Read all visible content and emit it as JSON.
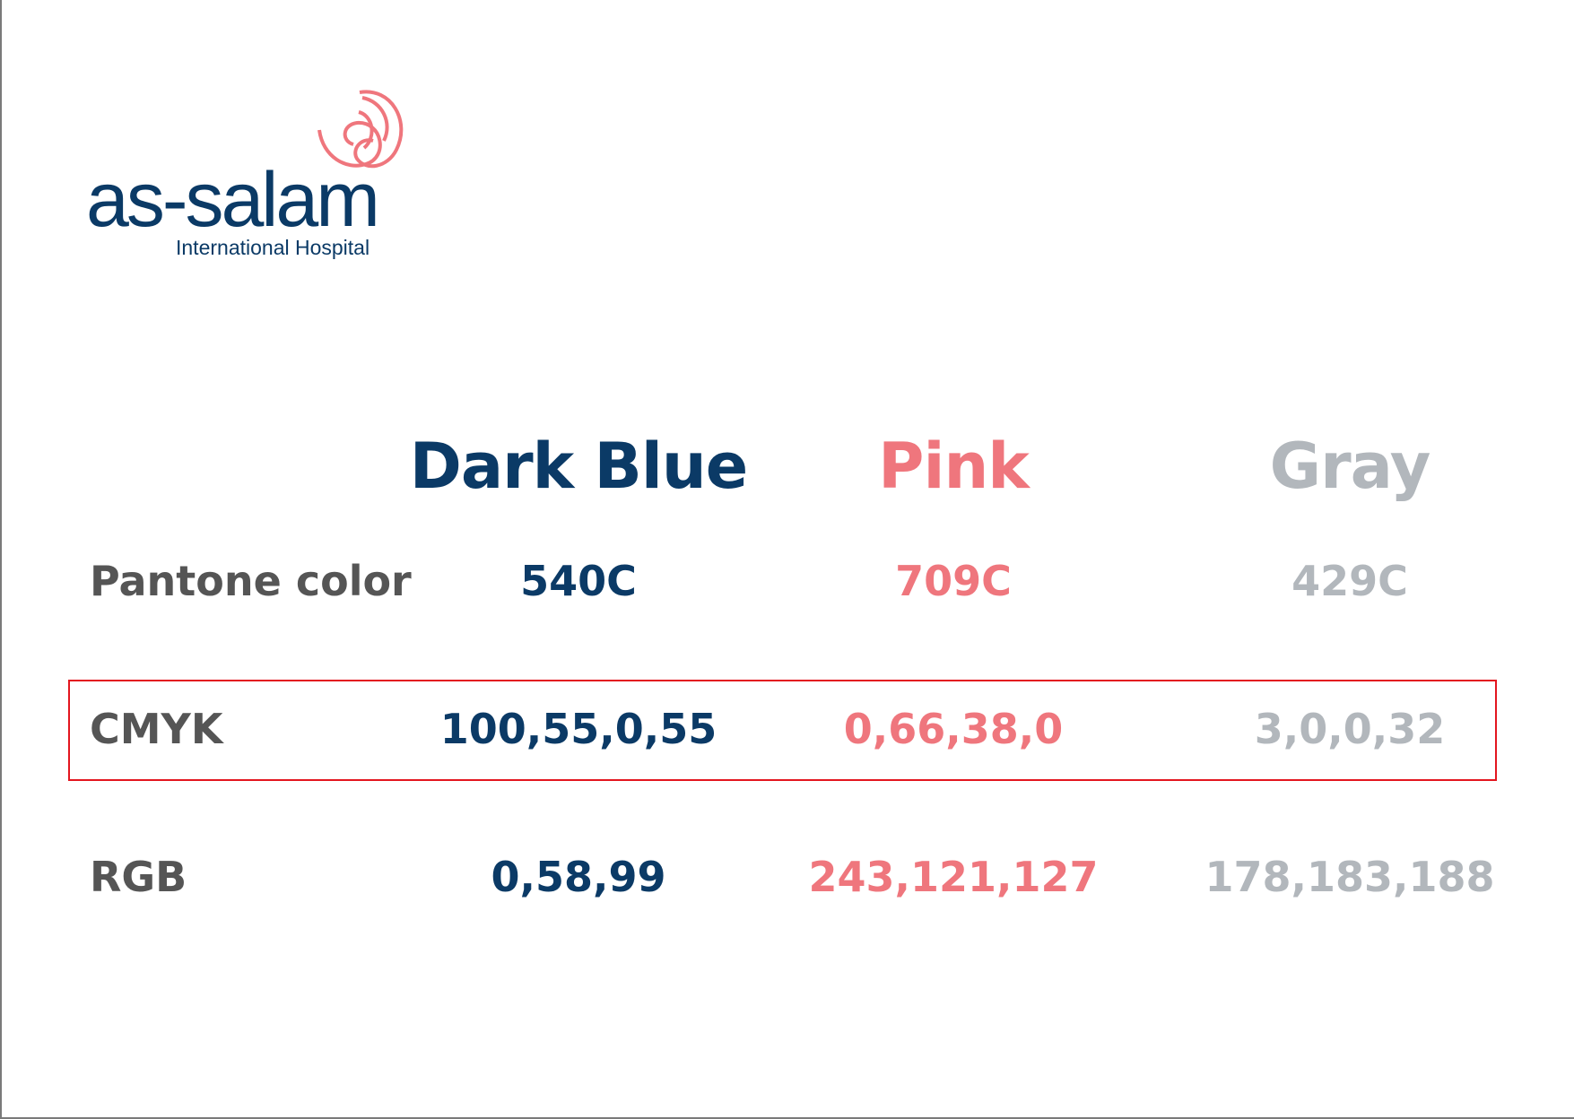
{
  "logo": {
    "name": "as-salam",
    "subtitle": "International Hospital"
  },
  "columns": [
    {
      "label": "Dark Blue",
      "color": "#0b3a66"
    },
    {
      "label": "Pink",
      "color": "#ef767d"
    },
    {
      "label": "Gray",
      "color": "#b2b7bc"
    }
  ],
  "rows": {
    "pantone": {
      "label": "Pantone color",
      "values": [
        "540C",
        "709C",
        "429C"
      ]
    },
    "cmyk": {
      "label": "CMYK",
      "values": [
        "100,55,0,55",
        "0,66,38,0",
        "3,0,0,32"
      ]
    },
    "rgb": {
      "label": "RGB",
      "values": [
        "0,58,99",
        "243,121,127",
        "178,183,188"
      ]
    }
  },
  "colors": {
    "label_gray": "#555555",
    "highlight_red": "#e3161f"
  }
}
